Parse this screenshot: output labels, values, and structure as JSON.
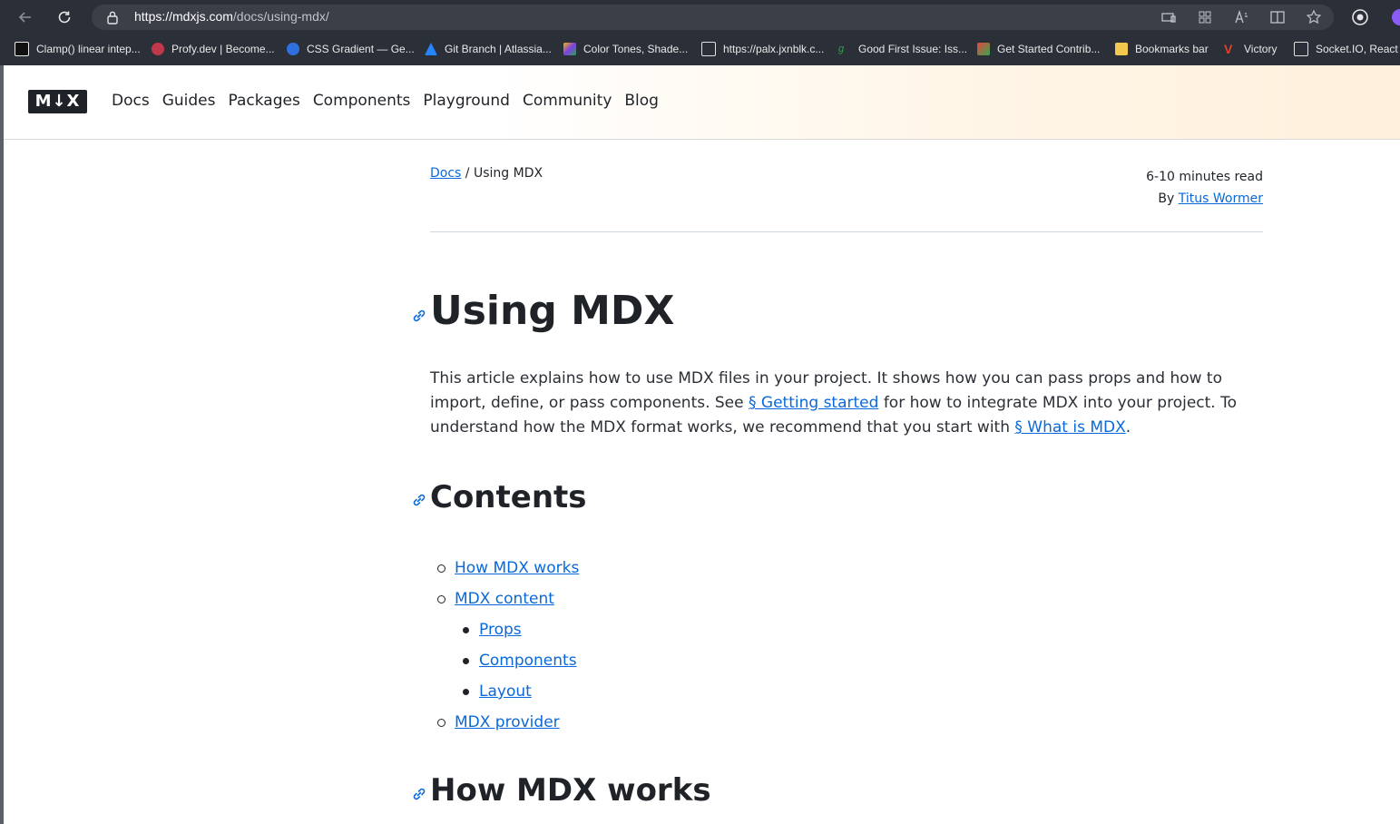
{
  "browser": {
    "url_host": "https://mdxjs.com",
    "url_path": "/docs/using-mdx/",
    "bookmarks": [
      {
        "label": "Clamp() linear intep...",
        "color": "#111111"
      },
      {
        "label": "Profy.dev | Become...",
        "color": "#c0394b"
      },
      {
        "label": "CSS Gradient — Ge...",
        "color": "#2f6fde"
      },
      {
        "label": "Git Branch | Atlassia...",
        "color": "#2684ff"
      },
      {
        "label": "Color Tones, Shade...",
        "color": "#f4b400"
      },
      {
        "label": "https://palx.jxnblk.c...",
        "color": "#e0e0e0"
      },
      {
        "label": "Good First Issue: Iss...",
        "color": "#2da44e"
      },
      {
        "label": "Get Started Contrib...",
        "color": "#e8453c"
      },
      {
        "label": "Bookmarks bar",
        "color": "#f2c94c"
      },
      {
        "label": "Victory",
        "color": "#e0442b"
      },
      {
        "label": "Socket.IO, React a",
        "color": "#e0e0e0"
      }
    ]
  },
  "site": {
    "logo": "M↓X",
    "nav": [
      "Docs",
      "Guides",
      "Packages",
      "Components",
      "Playground",
      "Community",
      "Blog"
    ]
  },
  "page": {
    "breadcrumb_link": "Docs",
    "breadcrumb_sep": " / ",
    "breadcrumb_current": "Using MDX",
    "read_time": "6-10 minutes read",
    "by_label": "By ",
    "author": "Titus Wormer",
    "title": "Using MDX",
    "lead_1": "This article explains how to use MDX files in your project. It shows how you can pass props and how to import, define, or pass components. See ",
    "lead_link_1": "§ Getting started",
    "lead_2": " for how to integrate MDX into your project. To understand how the MDX format works, we recommend that you start with ",
    "lead_link_2": "§ What is MDX",
    "lead_3": ".",
    "contents_heading": "Contents",
    "toc": {
      "how_mdx_works": "How MDX works",
      "mdx_content": "MDX content",
      "props": "Props",
      "components": "Components",
      "layout": "Layout",
      "mdx_provider": "MDX provider"
    },
    "next_heading": "How MDX works"
  }
}
